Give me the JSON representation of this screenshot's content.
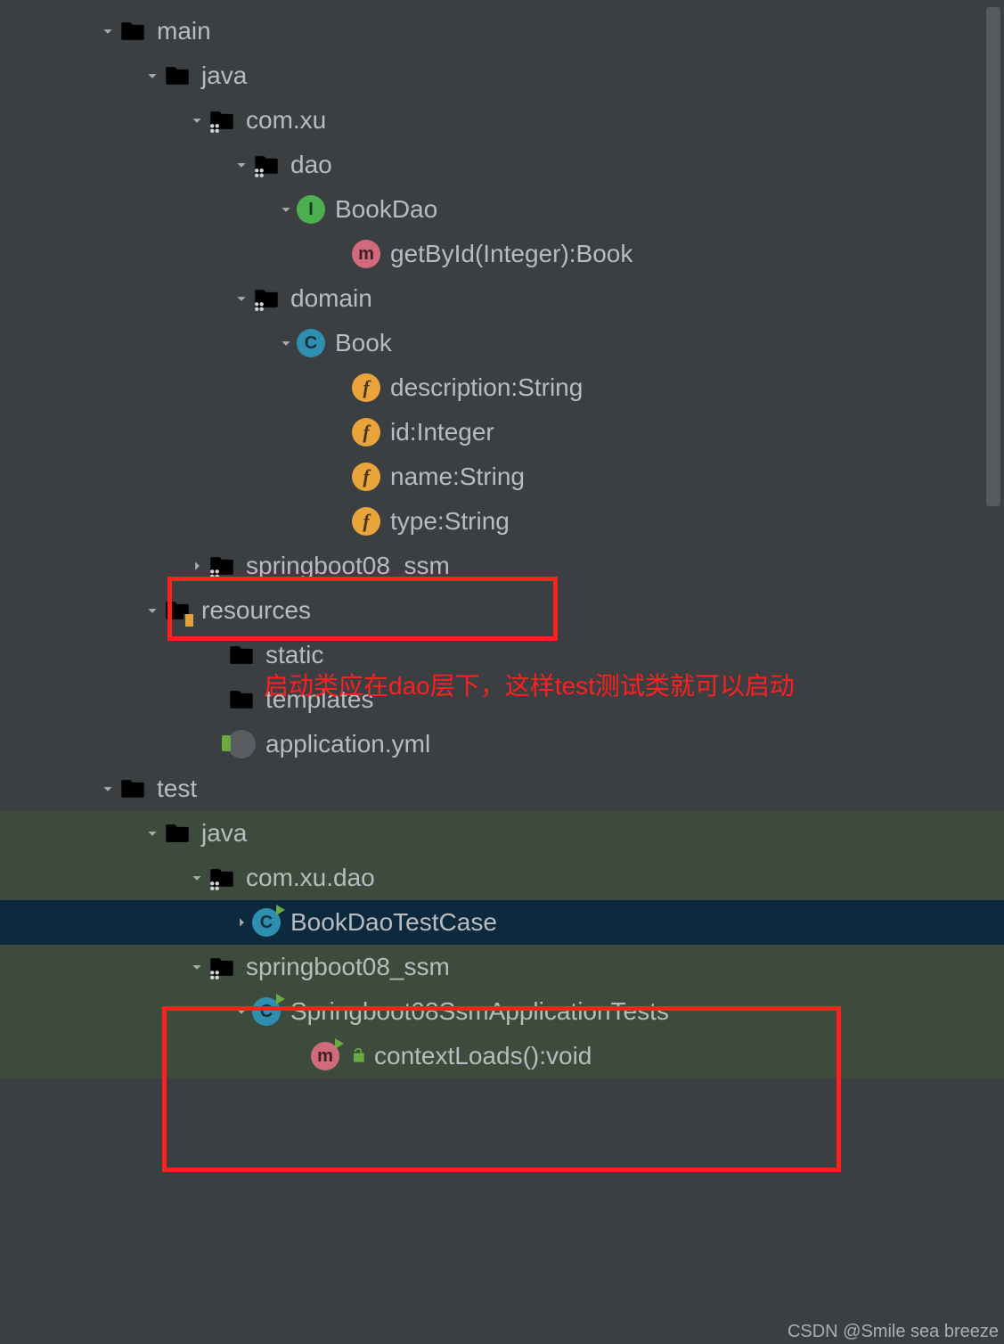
{
  "tree": {
    "main": "main",
    "java": "java",
    "comxu": "com.xu",
    "dao": "dao",
    "bookdao": "BookDao",
    "getbyid": "getById(Integer):Book",
    "domain": "domain",
    "book": "Book",
    "f_desc": "description:String",
    "f_id": "id:Integer",
    "f_name": "name:String",
    "f_type": "type:String",
    "sb08": "springboot08_ssm",
    "resources": "resources",
    "static": "static",
    "templates": "templates",
    "appyml": "application.yml",
    "test": "test",
    "t_java": "java",
    "t_comxudao": "com.xu.dao",
    "t_bdtc": "BookDaoTestCase",
    "t_sb08": "springboot08_ssm",
    "t_sbapptests": "Springboot08SsmApplicationTests",
    "t_contextloads": "contextLoads():void"
  },
  "annotation": "启动类应在dao层下，这样test测试类就可以启动",
  "watermark": "CSDN @Smile sea breeze"
}
